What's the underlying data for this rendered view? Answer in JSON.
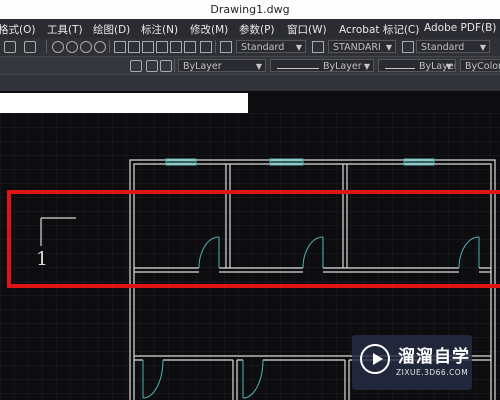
{
  "window": {
    "title": "Drawing1.dwg"
  },
  "menu": [
    "格式(O)",
    "工具(T)",
    "绘图(D)",
    "标注(N)",
    "修改(M)",
    "参数(P)",
    "窗口(W)",
    "Acrobat 标记(C)",
    "Adobe PDF(B)"
  ],
  "toolbar": {
    "text_style": "Standard",
    "dim_style": "STANDARI",
    "table_style": "Standard",
    "layer_color": "ByLayer",
    "linetype": "ByLayer",
    "lineweight": "ByLayer",
    "plot_style": "ByColor"
  },
  "drawing": {
    "label_text": "1",
    "highlight_color": "#e01414",
    "wall_color": "#dcdcdc",
    "window_color": "#4fb3b3",
    "door_color": "#4fb3b3",
    "background": "#0d0d0f",
    "grid_color": "#24252a"
  },
  "watermark": {
    "cn": "溜溜自学",
    "en": "ZIXUE.3D66.COM"
  }
}
